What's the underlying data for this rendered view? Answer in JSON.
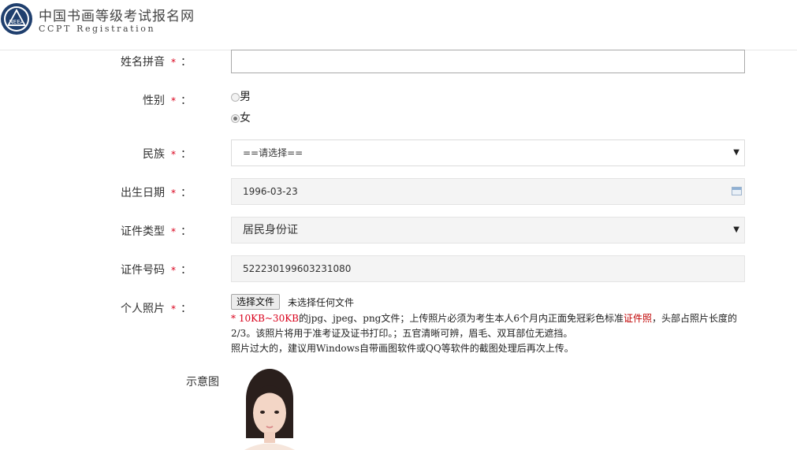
{
  "header": {
    "title": "中国书画等级考试报名网",
    "subtitle": "CCPT Registration",
    "logo_icon": "neea-logo-icon"
  },
  "form": {
    "pinyin": {
      "label": "姓名拼音",
      "required": "*",
      "colon": "：",
      "value": ""
    },
    "gender": {
      "label": "性别",
      "required": "*",
      "colon": "：",
      "options": [
        "男",
        "女"
      ],
      "selected": "女"
    },
    "ethnicity": {
      "label": "民族",
      "required": "*",
      "colon": "：",
      "value": "==请选择=="
    },
    "birthdate": {
      "label": "出生日期",
      "required": "*",
      "colon": "：",
      "value": "1996-03-23"
    },
    "id_type": {
      "label": "证件类型",
      "required": "*",
      "colon": "：",
      "value": "居民身份证"
    },
    "id_number": {
      "label": "证件号码",
      "required": "*",
      "colon": "：",
      "value": "522230199603231080"
    },
    "photo": {
      "label": "个人照片",
      "required": "*",
      "colon": "：",
      "button_label": "选择文件",
      "no_file_text": "未选择任何文件",
      "hint_star": "*",
      "hint_size": "10KB~30KB",
      "hint_part1": "的jpg、jpeg、png文件；上传照片必须为考生本人6个月内正面免冠彩色标准",
      "hint_link": "证件照",
      "hint_part2": "，头部占照片长度的2/3。该照片将用于准考证及证书打印。；五官清晰可辨，眉毛、双耳部位无遮挡。",
      "hint_line3": "照片过大的，建议用Windows自带画图软件或QQ等软件的截图处理后再次上传。"
    },
    "example": {
      "label": "示意图"
    }
  },
  "colors": {
    "required": "#d9001b",
    "link": "#c00000",
    "field_border": "#dcdcdc"
  }
}
